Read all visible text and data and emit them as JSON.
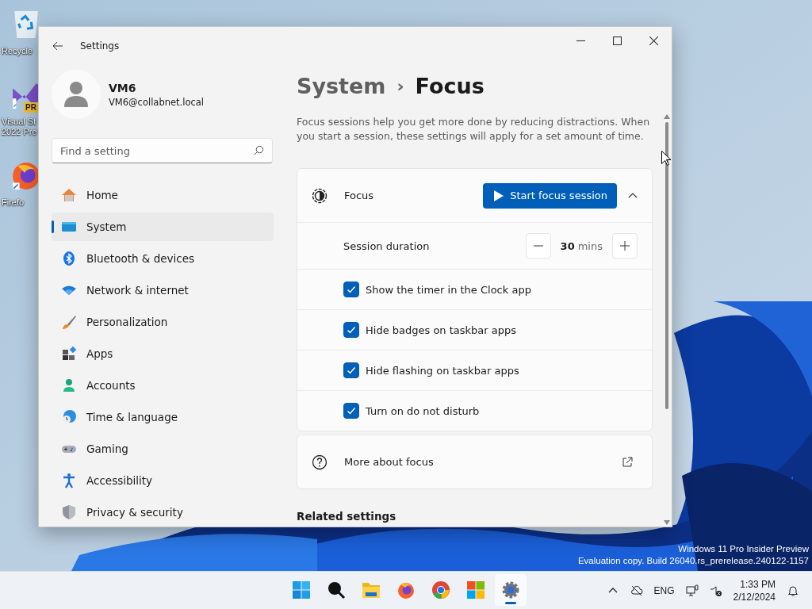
{
  "desktop_icons": [
    {
      "kind": "recycle-bin",
      "lines": [
        "Recycle"
      ]
    },
    {
      "kind": "code-editor",
      "badge": "PR",
      "lines": [
        "Visual St",
        "2022 Pre"
      ]
    },
    {
      "kind": "browser",
      "lines": [
        "Firefo"
      ]
    }
  ],
  "window": {
    "title": "Settings",
    "user": {
      "name": "VM6",
      "email": "VM6@collabnet.local"
    },
    "search": {
      "placeholder": "Find a setting"
    },
    "nav": [
      {
        "kind": "home",
        "label": "Home",
        "selected": false
      },
      {
        "kind": "system",
        "label": "System",
        "selected": true
      },
      {
        "kind": "bluetooth",
        "label": "Bluetooth & devices",
        "selected": false
      },
      {
        "kind": "network",
        "label": "Network & internet",
        "selected": false
      },
      {
        "kind": "personalization",
        "label": "Personalization",
        "selected": false
      },
      {
        "kind": "apps",
        "label": "Apps",
        "selected": false
      },
      {
        "kind": "accounts",
        "label": "Accounts",
        "selected": false
      },
      {
        "kind": "time",
        "label": "Time & language",
        "selected": false
      },
      {
        "kind": "gaming",
        "label": "Gaming",
        "selected": false
      },
      {
        "kind": "accessibility",
        "label": "Accessibility",
        "selected": false
      },
      {
        "kind": "privacy",
        "label": "Privacy & security",
        "selected": false
      }
    ],
    "breadcrumb": {
      "parent": "System",
      "separator": "›",
      "current": "Focus"
    },
    "description": "Focus sessions help you get more done by reducing distractions. When you start a session, these settings will apply for a set amount of time.",
    "focus_card": {
      "title": "Focus",
      "button": "Start focus session",
      "expanded": true,
      "duration": {
        "label": "Session duration",
        "value": "30",
        "unit": "mins"
      },
      "options": [
        {
          "label": "Show the timer in the Clock app",
          "checked": true
        },
        {
          "label": "Hide badges on taskbar apps",
          "checked": true
        },
        {
          "label": "Hide flashing on taskbar apps",
          "checked": true
        },
        {
          "label": "Turn on do not disturb",
          "checked": true
        }
      ]
    },
    "more_card": {
      "label": "More about focus"
    },
    "related_heading": "Related settings"
  },
  "watermark": [
    "Windows 11 Pro Insider Preview",
    "Evaluation copy. Build 26040.rs_prerelease.240122-1157"
  ],
  "taskbar": {
    "apps": [
      {
        "kind": "start",
        "active": false
      },
      {
        "kind": "search",
        "active": false
      },
      {
        "kind": "folder",
        "active": false
      },
      {
        "kind": "firefox",
        "active": false
      },
      {
        "kind": "chrome",
        "active": false
      },
      {
        "kind": "store",
        "active": false
      },
      {
        "kind": "settings",
        "active": true
      }
    ],
    "language": "ENG",
    "time": "1:33 PM",
    "date": "2/12/2024"
  }
}
